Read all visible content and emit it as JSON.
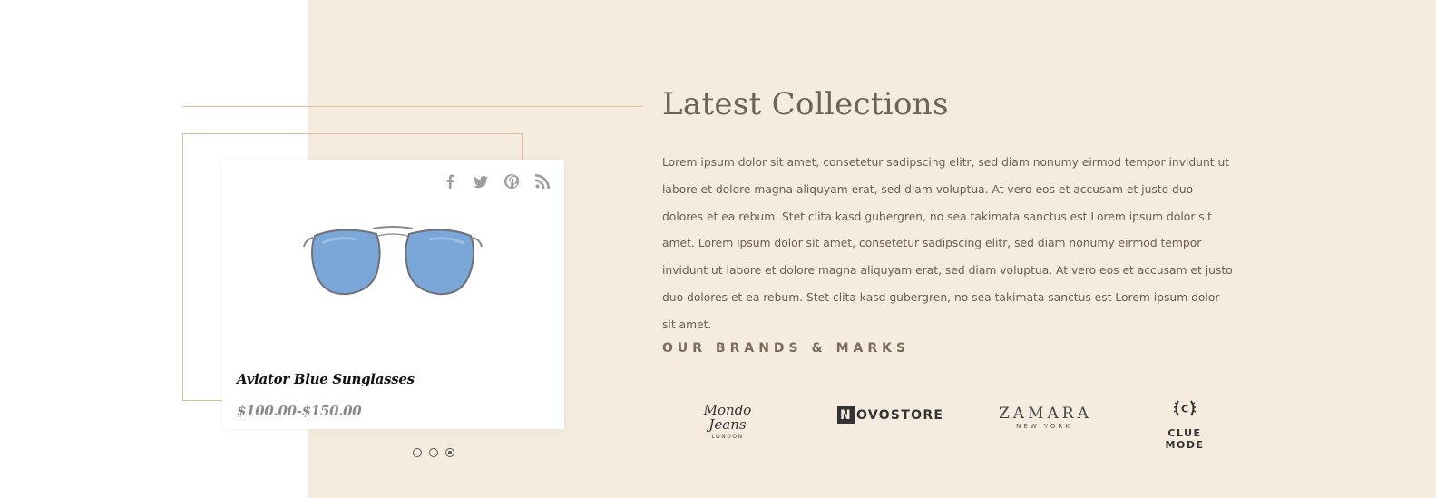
{
  "product": {
    "name": "Aviator Blue Sunglasses",
    "price": "$100.00-$150.00",
    "social_icons": [
      "facebook-icon",
      "twitter-icon",
      "pinterest-icon",
      "rss-icon"
    ],
    "lens_color": "#7aa6d8"
  },
  "carousel": {
    "dots": 3,
    "active_dot": 3
  },
  "section": {
    "heading": "Latest Collections",
    "paragraph": "Lorem ipsum dolor sit amet, consetetur sadipscing elitr, sed diam nonumy eirmod tempor invidunt ut labore et dolore magna aliquyam erat, sed diam voluptua. At vero eos et accusam et justo duo dolores et ea rebum. Stet clita kasd gubergren, no sea takimata sanctus est Lorem ipsum dolor sit amet. Lorem ipsum dolor sit amet, consetetur sadipscing elitr, sed diam nonumy eirmod tempor invidunt ut labore et dolore magna aliquyam erat, sed diam voluptua. At vero eos et accusam et justo duo dolores et ea rebum. Stet clita kasd gubergren, no sea takimata sanctus est Lorem ipsum dolor sit amet."
  },
  "brands": {
    "title": "OUR BRANDS & MARKS",
    "mondo": {
      "name": "Mondo Jeans",
      "sub": "LONDON"
    },
    "novo": {
      "letter": "N",
      "rest": "OVOSTORE"
    },
    "zamara": {
      "name": "ZAMARA",
      "sub": "NEW YORK"
    },
    "clue": {
      "emblem_letter": "C",
      "name": "CLUE MODE"
    }
  },
  "colors": {
    "beige_background": "#f5ebde",
    "line_accent": "#d9bfa0",
    "heading": "#6e6356",
    "body_text": "#6b5d50"
  }
}
